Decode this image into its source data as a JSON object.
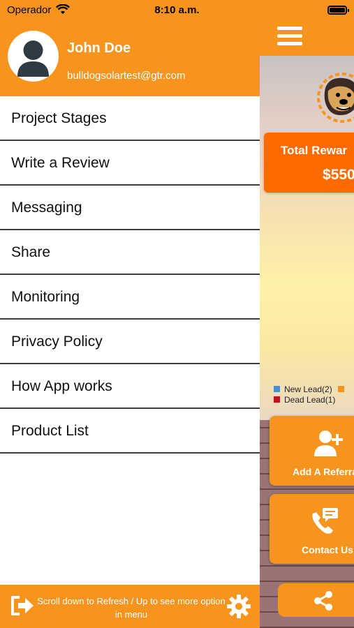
{
  "status_bar": {
    "carrier": "Operador",
    "time": "8:10 a.m."
  },
  "drawer": {
    "user_name": "John Doe",
    "user_email": "bulldogsolartest@gtr.com",
    "menu": [
      {
        "label": "Project Stages"
      },
      {
        "label": "Write a Review"
      },
      {
        "label": "Messaging"
      },
      {
        "label": "Share"
      },
      {
        "label": "Monitoring"
      },
      {
        "label": "Privacy Policy"
      },
      {
        "label": "How App works"
      },
      {
        "label": "Product List"
      }
    ],
    "footer_text": "Scroll down to Refresh / Up to see more option in menu"
  },
  "main": {
    "reward_label": "Total Rewar",
    "reward_value": "$550",
    "legend": [
      {
        "label": "New Lead(2)",
        "color": "#4a90d9"
      },
      {
        "label": "Dead Lead(1)",
        "color": "#c0161b"
      }
    ],
    "legend_extra_color": "#f7941d",
    "add_referral_label": "Add A Referra",
    "contact_label": "Contact Us"
  },
  "colors": {
    "accent": "#f7941d",
    "reward": "#ff6a00"
  }
}
